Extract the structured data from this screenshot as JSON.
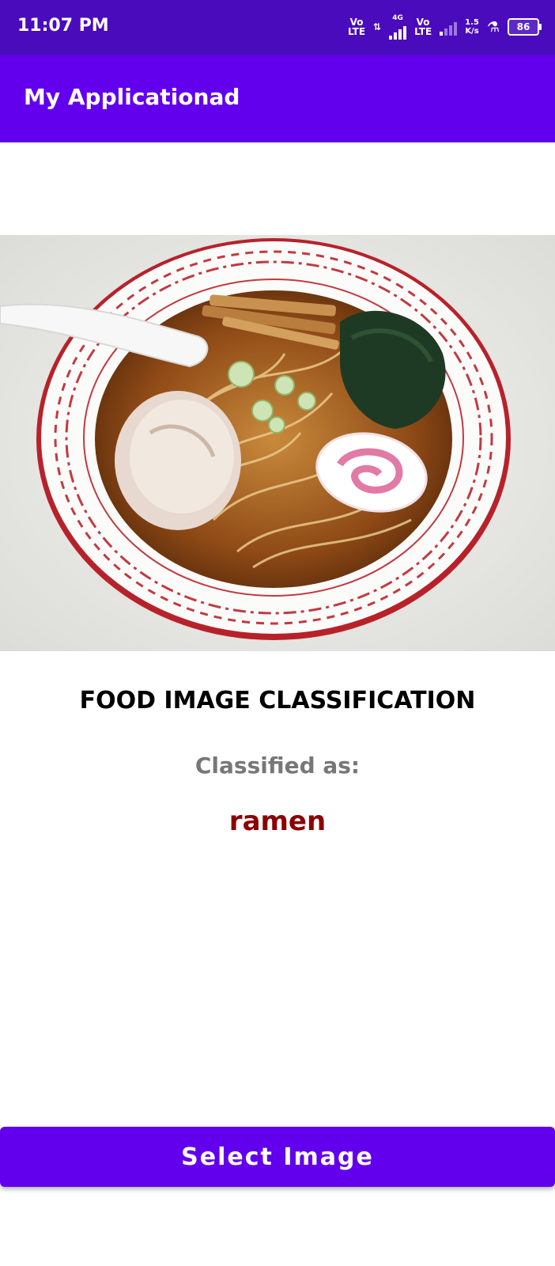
{
  "status_bar": {
    "time": "11:07 PM",
    "volte1_top": "Vo",
    "volte1_bottom": "LTE",
    "network": "4G",
    "volte2_top": "Vo",
    "volte2_bottom": "LTE",
    "speed_value": "1.5",
    "speed_unit": "K/s",
    "battery": "86"
  },
  "app_bar": {
    "title": "My Applicationad"
  },
  "main": {
    "heading": "FOOD IMAGE CLASSIFICATION",
    "classified_label": "Classified as:",
    "result": "ramen"
  },
  "button": {
    "label": "Select Image"
  },
  "colors": {
    "status_bar": "#4a0bbd",
    "app_bar": "#6200ee",
    "result_text": "#8b0000"
  }
}
